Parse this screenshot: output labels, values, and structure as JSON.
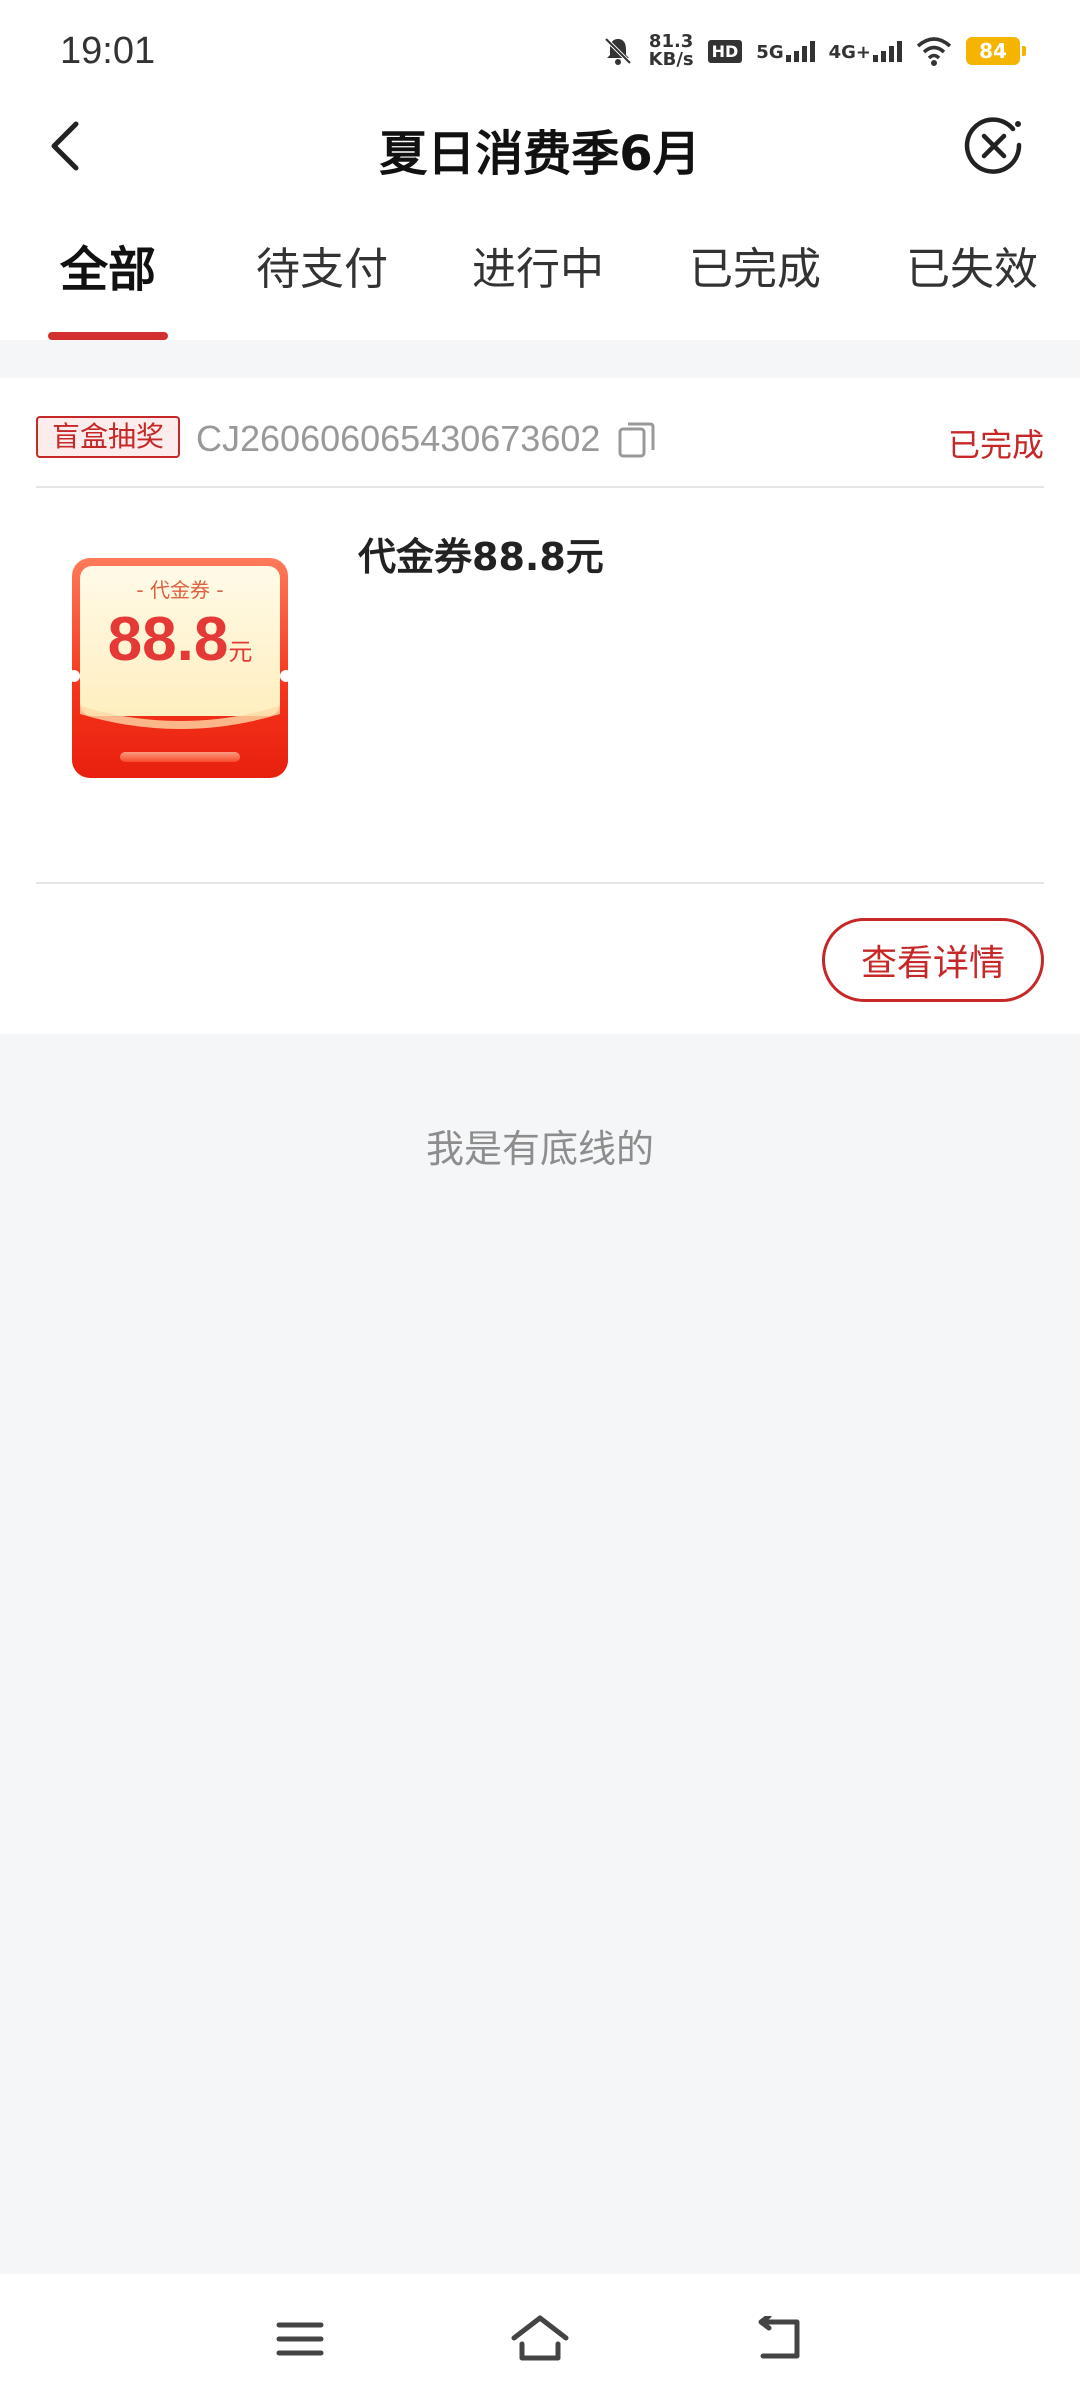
{
  "status_bar": {
    "time": "19:01",
    "net_speed_value": "81.3",
    "net_speed_unit": "KB/s",
    "hd_label": "HD",
    "signal1_label": "5G",
    "signal2_label": "4G+",
    "battery": "84",
    "battery_color": "#f4b400"
  },
  "header": {
    "title": "夏日消费季6月",
    "back_icon": "back-arrow-icon",
    "close_icon": "close-circle-icon"
  },
  "tabs": [
    {
      "label": "全部",
      "active": true
    },
    {
      "label": "待支付",
      "active": false
    },
    {
      "label": "进行中",
      "active": false
    },
    {
      "label": "已完成",
      "active": false
    },
    {
      "label": "已失效",
      "active": false
    }
  ],
  "order": {
    "tag": "盲盒抽奖",
    "order_no": "CJ260606065430673602",
    "status": "已完成",
    "item_title": "代金券88.8元",
    "coupon": {
      "label": "- 代金券 -",
      "amount": "88.8",
      "unit": "元"
    },
    "detail_button": "查看详情"
  },
  "footer_note": "我是有底线的",
  "accent_color": "#c62828",
  "nav": {
    "menu_icon": "menu-icon",
    "home_icon": "home-icon",
    "back_icon": "back-icon"
  }
}
